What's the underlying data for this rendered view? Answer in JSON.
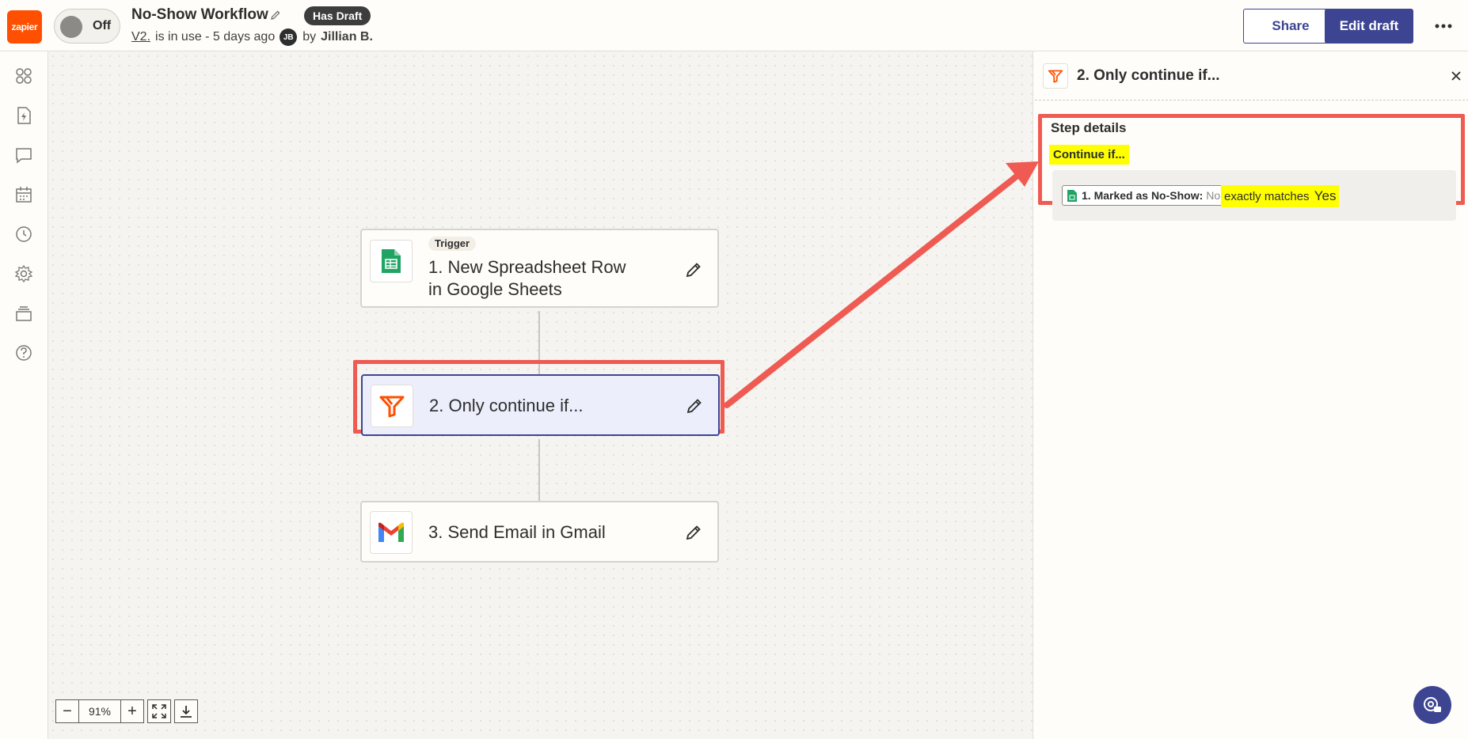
{
  "header": {
    "logo_text": "zapier",
    "toggle_label": "Off",
    "workflow_title": "No-Show Workflow",
    "draft_badge": "Has Draft",
    "version_link": "V2.",
    "version_status": "is in use - 5 days ago",
    "avatar_initials": "JB",
    "by_label": "by",
    "author_name": "Jillian B.",
    "share_label": "Share",
    "edit_draft_label": "Edit draft"
  },
  "sidebar": {
    "icons": [
      "apps-icon",
      "zap-file-icon",
      "comment-icon",
      "calendar-icon",
      "history-icon",
      "settings-icon",
      "layers-icon",
      "help-icon"
    ]
  },
  "canvas": {
    "steps": [
      {
        "tag": "Trigger",
        "title_line1": "1. New Spreadsheet Row",
        "title_line2": "in Google Sheets",
        "app": "google-sheets"
      },
      {
        "title": "2. Only continue if...",
        "app": "filter"
      },
      {
        "title": "3. Send Email in Gmail",
        "app": "gmail"
      }
    ],
    "zoom": {
      "minus": "−",
      "value": "91%",
      "plus": "+"
    }
  },
  "panel": {
    "title": "2. Only continue if...",
    "step_details_label": "Step details",
    "continue_if_label": "Continue if...",
    "condition": {
      "field_name": "1. Marked as No-Show:",
      "field_value": "No",
      "operator": "exactly matches",
      "value": "Yes"
    }
  },
  "colors": {
    "accent": "#3d4592",
    "zapier_orange": "#ff4f00",
    "annotation_red": "#ef5a52",
    "highlight_yellow": "#ffff00"
  }
}
